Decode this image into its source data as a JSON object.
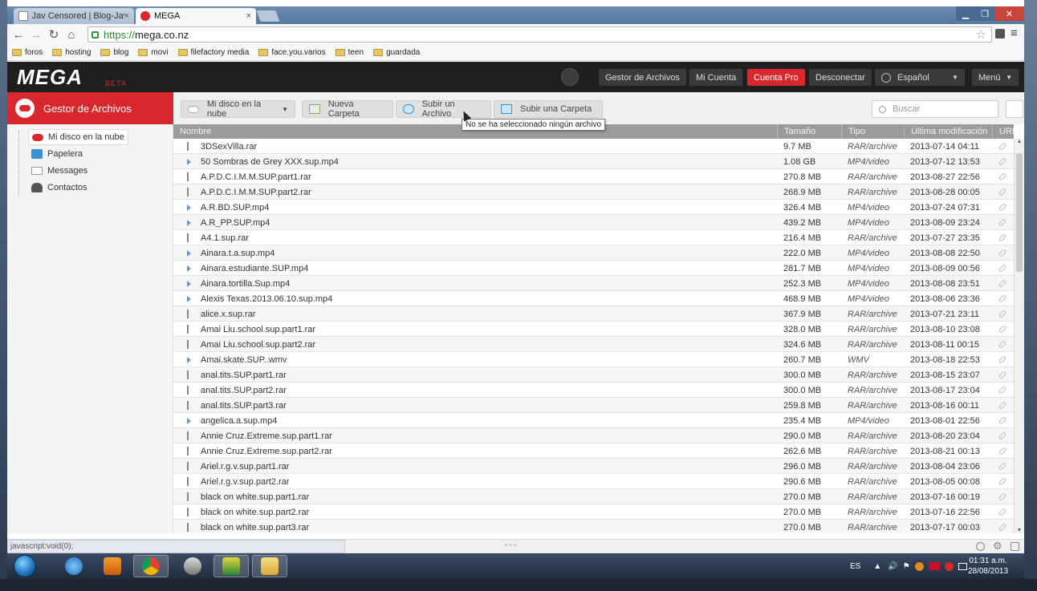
{
  "browser": {
    "tabs": [
      {
        "label": "Jav Censored | Blog-Jav.ne",
        "close": "×"
      },
      {
        "label": "MEGA",
        "close": "×"
      }
    ],
    "url_scheme": "https://",
    "url_host": "mega.co.nz",
    "bookmarks": [
      "foros",
      "hosting",
      "blog",
      "movi",
      "filefactory media",
      "face.you.varios",
      "teen",
      "guardada"
    ],
    "status_text": "javascript:void(0);"
  },
  "mega": {
    "logo": "MEGA",
    "beta": "BETA",
    "nav": {
      "file_manager": "Gestor de Archivos",
      "account": "Mi Cuenta",
      "pro": "Cuenta Pro",
      "logout": "Desconectar",
      "language": "Español",
      "menu": "Menú"
    },
    "sidebar": {
      "title": "Gestor de Archivos",
      "items": [
        "Mi disco en la nube",
        "Papelera",
        "Messages",
        "Contactos"
      ]
    },
    "actions": {
      "location": "Mi disco en la nube",
      "new_folder": "Nueva Carpeta",
      "upload_file": "Subir un Archivo",
      "upload_folder": "Subir una Carpeta",
      "search_placeholder": "Buscar",
      "tooltip": "No se ha seleccionado ningún archivo"
    },
    "columns": {
      "name": "Nombre",
      "size": "Tamaño",
      "type": "Tipo",
      "modified": "Última modificación",
      "url": "URL"
    },
    "files": [
      {
        "name": "3DSexVilla.rar",
        "size": "9.7 MB",
        "type": "RAR/archive",
        "date": "2013-07-14 04:11",
        "kind": "rar"
      },
      {
        "name": "50 Sombras de Grey XXX.sup.mp4",
        "size": "1.08 GB",
        "type": "MP4/video",
        "date": "2013-07-12 13:53",
        "kind": "video"
      },
      {
        "name": "A.P.D.C.I.M.M.SUP.part1.rar",
        "size": "270.8 MB",
        "type": "RAR/archive",
        "date": "2013-08-27 22:56",
        "kind": "rar"
      },
      {
        "name": "A.P.D.C.I.M.M.SUP.part2.rar",
        "size": "268.9 MB",
        "type": "RAR/archive",
        "date": "2013-08-28 00:05",
        "kind": "rar"
      },
      {
        "name": "A.R.BD.SUP.mp4",
        "size": "326.4 MB",
        "type": "MP4/video",
        "date": "2013-07-24 07:31",
        "kind": "video"
      },
      {
        "name": "A.R_PP.SUP.mp4",
        "size": "439.2 MB",
        "type": "MP4/video",
        "date": "2013-08-09 23:24",
        "kind": "video"
      },
      {
        "name": "A4.1.sup.rar",
        "size": "216.4 MB",
        "type": "RAR/archive",
        "date": "2013-07-27 23:35",
        "kind": "rar"
      },
      {
        "name": "Ainara.t.a.sup.mp4",
        "size": "222.0 MB",
        "type": "MP4/video",
        "date": "2013-08-08 22:50",
        "kind": "video"
      },
      {
        "name": "Ainara.estudiante.SUP.mp4",
        "size": "281.7 MB",
        "type": "MP4/video",
        "date": "2013-08-09 00:56",
        "kind": "video"
      },
      {
        "name": "Ainara.tortilla.Sup.mp4",
        "size": "252.3 MB",
        "type": "MP4/video",
        "date": "2013-08-08 23:51",
        "kind": "video"
      },
      {
        "name": "Alexis Texas.2013.06.10.sup.mp4",
        "size": "468.9 MB",
        "type": "MP4/video",
        "date": "2013-08-06 23:36",
        "kind": "video"
      },
      {
        "name": "alice.x.sup.rar",
        "size": "367.9 MB",
        "type": "RAR/archive",
        "date": "2013-07-21 23:11",
        "kind": "rar"
      },
      {
        "name": "Amai Liu.school.sup.part1.rar",
        "size": "328.0 MB",
        "type": "RAR/archive",
        "date": "2013-08-10 23:08",
        "kind": "rar"
      },
      {
        "name": "Amai Liu.school.sup.part2.rar",
        "size": "324.6 MB",
        "type": "RAR/archive",
        "date": "2013-08-11 00:15",
        "kind": "rar"
      },
      {
        "name": "Amai.skate.SUP..wmv",
        "size": "260.7 MB",
        "type": "WMV",
        "date": "2013-08-18 22:53",
        "kind": "video"
      },
      {
        "name": "anal.tits.SUP.part1.rar",
        "size": "300.0 MB",
        "type": "RAR/archive",
        "date": "2013-08-15 23:07",
        "kind": "rar"
      },
      {
        "name": "anal.tits.SUP.part2.rar",
        "size": "300.0 MB",
        "type": "RAR/archive",
        "date": "2013-08-17 23:04",
        "kind": "rar"
      },
      {
        "name": "anal.tits.SUP.part3.rar",
        "size": "259.8 MB",
        "type": "RAR/archive",
        "date": "2013-08-16 00:11",
        "kind": "rar"
      },
      {
        "name": "angelica.a.sup.mp4",
        "size": "235.4 MB",
        "type": "MP4/video",
        "date": "2013-08-01 22:56",
        "kind": "video"
      },
      {
        "name": "Annie Cruz.Extreme.sup.part1.rar",
        "size": "290.0 MB",
        "type": "RAR/archive",
        "date": "2013-08-20 23:04",
        "kind": "rar"
      },
      {
        "name": "Annie Cruz.Extreme.sup.part2.rar",
        "size": "262.6 MB",
        "type": "RAR/archive",
        "date": "2013-08-21 00:13",
        "kind": "rar"
      },
      {
        "name": "Ariel.r.g.v.sup.part1.rar",
        "size": "296.0 MB",
        "type": "RAR/archive",
        "date": "2013-08-04 23:06",
        "kind": "rar"
      },
      {
        "name": "Ariel.r.g.v.sup.part2.rar",
        "size": "290.6 MB",
        "type": "RAR/archive",
        "date": "2013-08-05 00:08",
        "kind": "rar"
      },
      {
        "name": "black on white.sup.part1.rar",
        "size": "270.0 MB",
        "type": "RAR/archive",
        "date": "2013-07-16 00:19",
        "kind": "rar"
      },
      {
        "name": "black on white.sup.part2.rar",
        "size": "270.0 MB",
        "type": "RAR/archive",
        "date": "2013-07-16 22:56",
        "kind": "rar"
      },
      {
        "name": "black on white.sup.part3.rar",
        "size": "270.0 MB",
        "type": "RAR/archive",
        "date": "2013-07-17 00:03",
        "kind": "rar"
      }
    ]
  },
  "taskbar": {
    "lang": "ES",
    "time": "01:31 a.m.",
    "date": "28/08/2013"
  }
}
